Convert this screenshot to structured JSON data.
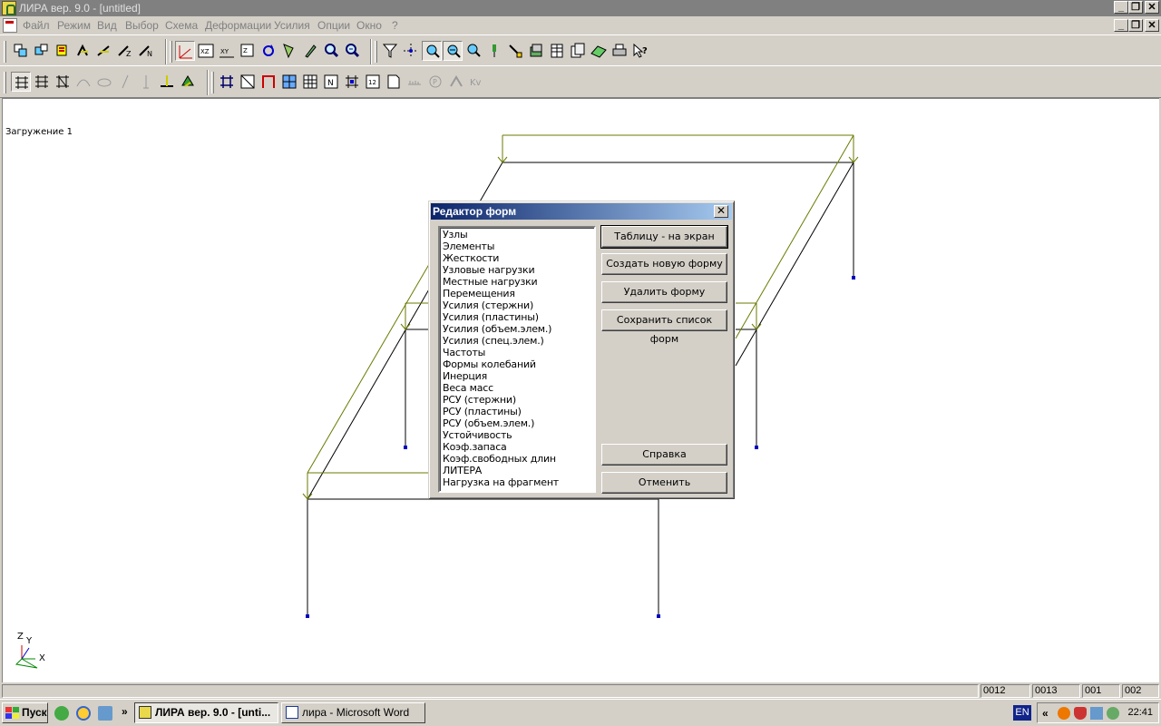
{
  "window": {
    "title": "ЛИРА  вер. 9.0 - [untitled]",
    "controls": [
      "_",
      "❐",
      "✕"
    ]
  },
  "menu": {
    "items": [
      "Файл",
      "Режим",
      "Вид",
      "Выбор",
      "Схема",
      "Деформации",
      "Усилия",
      "Опции",
      "Окно",
      "?"
    ]
  },
  "workspace": {
    "load_case_label": "Загружение  1",
    "axes": {
      "z": "Z",
      "y": "Y",
      "x": "X"
    }
  },
  "dialog": {
    "title": "Редактор форм",
    "close": "✕",
    "list_items": [
      "Узлы",
      "Элементы",
      "Жесткости",
      "Узловые нагрузки",
      "Местные нагрузки",
      "Перемещения",
      "Усилия (стержни)",
      "Усилия (пластины)",
      "Усилия (объем.элем.)",
      "Усилия (спец.элем.)",
      "Частоты",
      "Формы колебаний",
      "Инерция",
      "Веса масс",
      "РСУ (стержни)",
      "РСУ (пластины)",
      "РСУ (объем.элем.)",
      "Устойчивость",
      "Коэф.запаса",
      "Коэф.свободных длин",
      "ЛИТЕРА",
      "Нагрузка на фрагмент"
    ],
    "buttons": {
      "table_to_screen": "Таблицу - на экран",
      "create_form": "Создать новую форму",
      "delete_form": "Удалить форму",
      "save_list": "Сохранить список форм",
      "help": "Справка",
      "cancel": "Отменить"
    }
  },
  "statusbar": {
    "panels": [
      "0012",
      "0013",
      "001",
      "002"
    ]
  },
  "taskbar": {
    "start": "Пуск",
    "chevron": "»",
    "tasks": [
      {
        "label": "ЛИРА  вер. 9.0 - [unti...",
        "active": true
      },
      {
        "label": "лира - Microsoft Word",
        "active": false
      }
    ],
    "language": "EN",
    "tray_chevron": "«",
    "clock": "22:41"
  },
  "colors": {
    "frame_green": "#6b7a00",
    "frame_black": "#000000",
    "support_blue": "#0000c0",
    "title_active": "#0a246a"
  }
}
